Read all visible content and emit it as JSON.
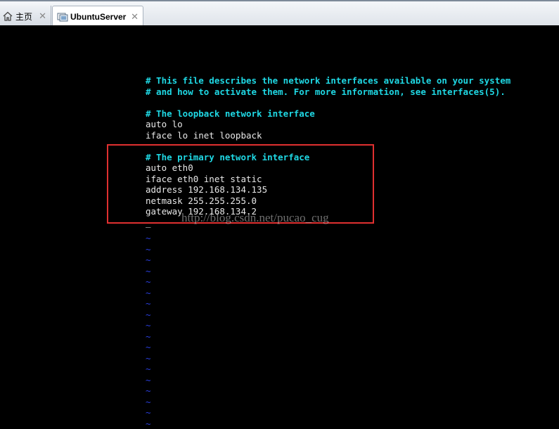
{
  "tabs": [
    {
      "label": "主页",
      "icon": "home-icon",
      "active": false
    },
    {
      "label": "UbuntuServer",
      "icon": "vm-icon",
      "active": true
    }
  ],
  "close_glyph": "✕",
  "editor": {
    "lines": [
      {
        "text": "# This file describes the network interfaces available on your system",
        "type": "comment"
      },
      {
        "text": "# and how to activate them. For more information, see interfaces(5).",
        "type": "comment"
      },
      {
        "text": "",
        "type": "blank"
      },
      {
        "text": "# The loopback network interface",
        "type": "comment"
      },
      {
        "text": "auto lo",
        "type": "code"
      },
      {
        "text": "iface lo inet loopback",
        "type": "code"
      },
      {
        "text": "",
        "type": "blank"
      },
      {
        "text": "# The primary network interface",
        "type": "comment"
      },
      {
        "text": "auto eth0",
        "type": "code"
      },
      {
        "text": "iface eth0 inet static",
        "type": "code"
      },
      {
        "text": "address 192.168.134.135",
        "type": "code"
      },
      {
        "text": "netmask 255.255.255.0",
        "type": "code"
      },
      {
        "text": "gateway 192.168.134.2",
        "type": "code"
      }
    ],
    "cursor": "_",
    "empty_line_marker": "~",
    "empty_line_count": 18
  },
  "watermark": "http://blog.csdn.net/pucao_cug",
  "colors": {
    "comment": "#1fd8e4",
    "code": "#e8e8e8",
    "tilde": "#2a3fe0",
    "highlight": "#e03030"
  }
}
